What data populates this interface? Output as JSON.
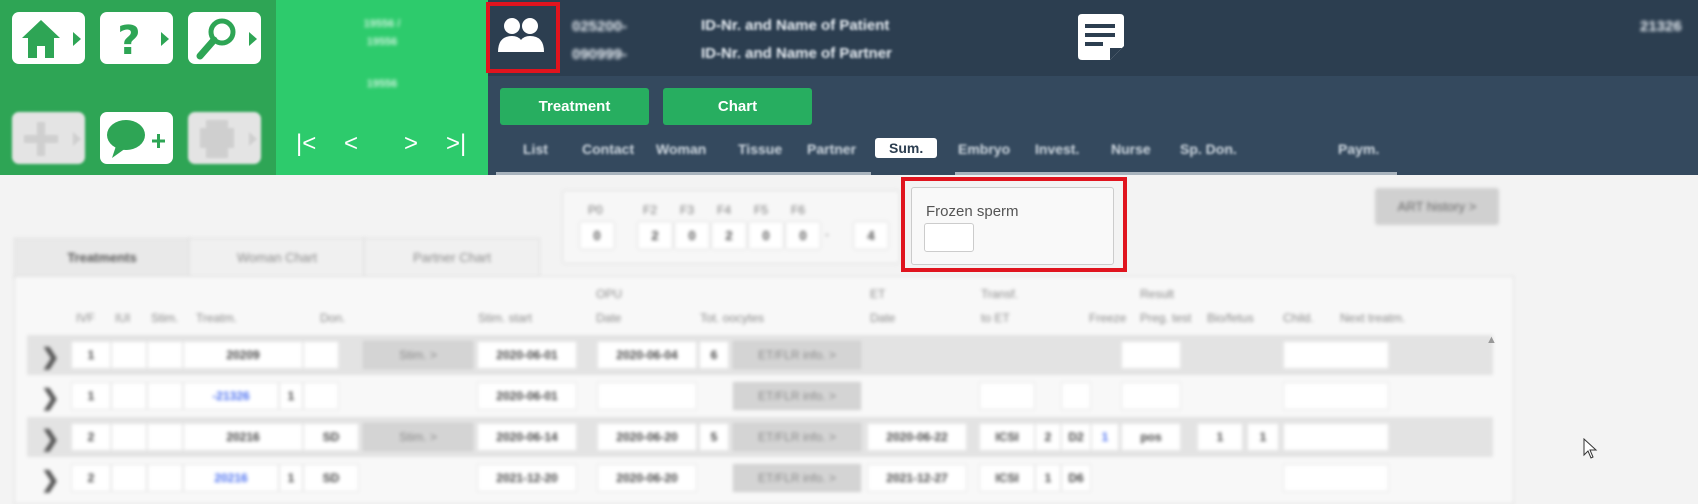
{
  "nav": {
    "buttons": [
      {
        "icon": "home-icon"
      },
      {
        "icon": "help-icon"
      },
      {
        "icon": "search-icon"
      },
      {
        "icon": "add-icon",
        "disabled": true
      },
      {
        "icon": "add-comment-icon"
      },
      {
        "icon": "printer-icon",
        "disabled": true
      }
    ],
    "record_top": "19556 /",
    "record_sub": "19556",
    "record_mid": "19556",
    "pager": {
      "first": "|<",
      "prev": "<",
      "next": ">",
      "last": ">|"
    }
  },
  "header": {
    "patient_id": "025200-",
    "partner_id": "090999-",
    "patient_label": "ID-Nr. and Name of Patient",
    "partner_label": "ID-Nr. and Name of Partner",
    "right_id": "21326",
    "buttons": {
      "treatment": "Treatment",
      "chart": "Chart"
    },
    "tabs": [
      "List",
      "Contact",
      "Woman",
      "Tissue",
      "Partner",
      "Sum.",
      "Embryo",
      "Invest.",
      "Nurse",
      "Sp. Don.",
      "Paym."
    ],
    "active_tab": "Sum."
  },
  "summary": {
    "labels": [
      "P0",
      "F2",
      "F3",
      "F4",
      "F5",
      "F6"
    ],
    "values": [
      "0",
      "2",
      "0",
      "2",
      "0",
      "0",
      "-",
      "4"
    ]
  },
  "frozen_sperm": {
    "label": "Frozen sperm",
    "value": ""
  },
  "art_history_label": "ART history >",
  "subtabs": [
    "Treatments",
    "Woman Chart",
    "Partner Chart"
  ],
  "table": {
    "headers_top": {
      "opu": "OPU",
      "et": "ET",
      "transf": "Transf.",
      "result": "Result"
    },
    "headers": [
      "IVF",
      "IUI",
      "Stim.",
      "Treatm.",
      "Don.",
      "Stim. start",
      "Date",
      "Tot. oocytes",
      "Date",
      "to ET",
      "Freeze",
      "Preg. test",
      "Bio/fetus",
      "Child.",
      "Next treatm."
    ],
    "stim_btn": "Stim. >",
    "et_btn": "ET/FLR info. >",
    "rows": [
      {
        "ivf": "1",
        "treatm": "20209",
        "don": "",
        "stim": true,
        "stim_start": "2020-06-01",
        "opu": "2020-06-04",
        "oocytes": "6",
        "et_date": "",
        "transf": "",
        "n": "",
        "freeze": "",
        "freeze_n": "",
        "preg": "",
        "bio": "",
        "child": "",
        "shade": true
      },
      {
        "ivf": "1",
        "treatm": "-21326",
        "treatm_n": "1",
        "don": "",
        "stim": false,
        "stim_start": "2020-06-01",
        "opu": "",
        "oocytes": "",
        "et_date": "",
        "transf": "",
        "n": "",
        "freeze": "",
        "freeze_n": "",
        "preg": "",
        "bio": "",
        "child": "",
        "link": true,
        "shade": false
      },
      {
        "ivf": "2",
        "treatm": "20216",
        "don": "SD",
        "stim": true,
        "stim_start": "2020-06-14",
        "opu": "2020-06-20",
        "oocytes": "5",
        "et_date": "2020-06-22",
        "transf": "ICSI",
        "n": "2",
        "freeze": "D2",
        "freeze_n": "1",
        "preg": "pos",
        "bio": "1",
        "child": "1",
        "shade": true
      },
      {
        "ivf": "2",
        "treatm": "20216",
        "treatm_n": "1",
        "don": "SD",
        "stim": false,
        "stim_start": "2021-12-20",
        "opu": "2020-06-20",
        "oocytes": "",
        "et_date": "2021-12-27",
        "transf": "ICSI",
        "n": "1",
        "freeze": "D6",
        "freeze_n": "",
        "preg": "",
        "bio": "",
        "child": "",
        "link": true,
        "shade": false
      }
    ]
  }
}
